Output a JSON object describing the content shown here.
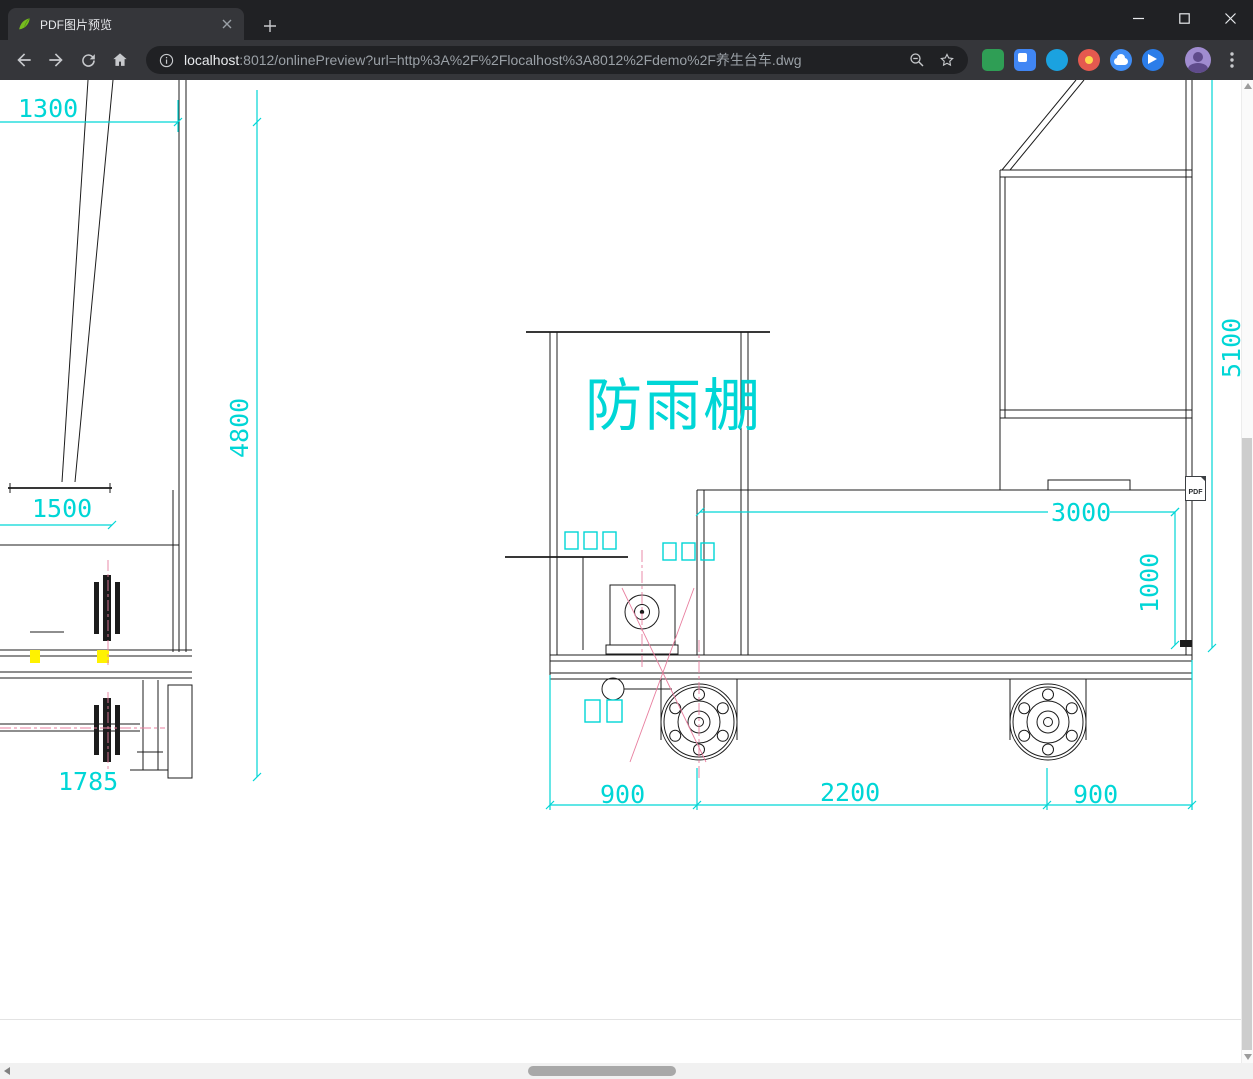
{
  "browser": {
    "tab_title": "PDF图片预览",
    "url_host": "localhost",
    "url_rest": ":8012/onlinePreview?url=http%3A%2F%2Flocalhost%3A8012%2Fdemo%2F养生台车.dwg"
  },
  "drawing": {
    "shelter_label": "防雨棚",
    "dims": {
      "d1300": "1300",
      "d4800": "4800",
      "d1500": "1500",
      "d1785": "1785",
      "d5100": "5100",
      "d3000": "3000",
      "d1000": "1000",
      "d900a": "900",
      "d2200": "2200",
      "d900b": "900"
    },
    "pdf_badge": "PDF",
    "colors": {
      "dimension_cyan": "#00d6d6",
      "highlight_yellow": "#fff200",
      "centerline_pink": "#e87f9f",
      "line_black": "#1c1c1c"
    }
  }
}
